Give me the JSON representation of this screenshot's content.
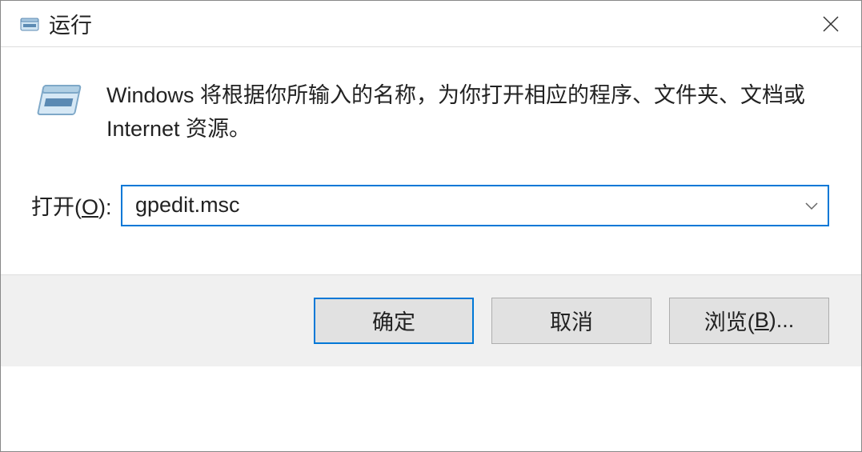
{
  "titlebar": {
    "title": "运行"
  },
  "content": {
    "description": "Windows 将根据你所输入的名称，为你打开相应的程序、文件夹、文档或 Internet 资源。"
  },
  "input": {
    "label_prefix": "打开(",
    "label_hotkey": "O",
    "label_suffix": "):",
    "value": "gpedit.msc"
  },
  "buttons": {
    "ok": "确定",
    "cancel": "取消",
    "browse_prefix": "浏览(",
    "browse_hotkey": "B",
    "browse_suffix": ")..."
  }
}
